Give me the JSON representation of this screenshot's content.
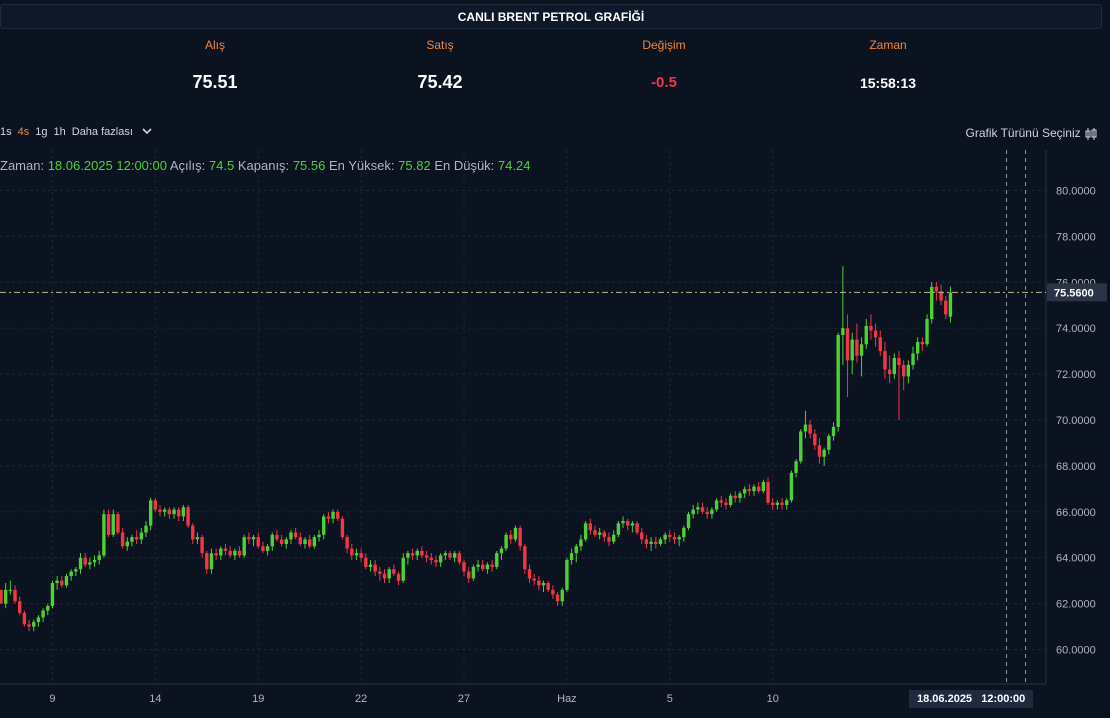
{
  "header": {
    "title": "CANLI BRENT PETROL GRAFİĞİ"
  },
  "stats": [
    {
      "label": "Alış",
      "value": "75.51"
    },
    {
      "label": "Satış",
      "value": "75.42"
    },
    {
      "label": "Değişim",
      "value": "-0.5"
    },
    {
      "label": "Zaman",
      "value": "15:58:13"
    }
  ],
  "toolbar": {
    "intervals": [
      "1s",
      "4s",
      "1g",
      "1h"
    ],
    "active_interval": "4s",
    "more_label": "Daha fazlası",
    "chart_type_label": "Grafik Türünü Seçiniz"
  },
  "ohlc_legend": {
    "time_label": "Zaman:",
    "time_value": "18.06.2025 12:00:00",
    "open_label": "Açılış:",
    "open_value": "74.5",
    "close_label": "Kapanış:",
    "close_value": "75.56",
    "high_label": "En Yüksek:",
    "high_value": "75.82",
    "low_label": "En Düşük:",
    "low_value": "74.24"
  },
  "crosshair_date_label": "18.06.2025   12:00:00",
  "colors": {
    "up": "#4cd137",
    "down": "#f23645",
    "background": "#0b1220",
    "accent": "#f0883e"
  },
  "chart_data": {
    "type": "candlestick",
    "title": "",
    "ylim": [
      58.5,
      81.5
    ],
    "y_ticks": [
      "80.0000",
      "78.0000",
      "76.0000",
      "74.0000",
      "72.0000",
      "70.0000",
      "68.0000",
      "66.0000",
      "64.0000",
      "62.0000",
      "60.0000"
    ],
    "x_ticks": [
      {
        "index": 11,
        "label": "9"
      },
      {
        "index": 33,
        "label": "14"
      },
      {
        "index": 55,
        "label": "19"
      },
      {
        "index": 77,
        "label": "22"
      },
      {
        "index": 99,
        "label": "27"
      },
      {
        "index": 121,
        "label": "Haz"
      },
      {
        "index": 143,
        "label": "5"
      },
      {
        "index": 165,
        "label": "10"
      }
    ],
    "last_price": "75.5600",
    "last_price_value": 75.56,
    "crosshair_index": 215,
    "candles": [
      [
        62.6,
        62.6,
        62.0,
        62.0
      ],
      [
        62.0,
        62.9,
        61.8,
        62.6
      ],
      [
        62.6,
        63.0,
        62.4,
        62.6
      ],
      [
        62.6,
        62.8,
        62.0,
        62.1
      ],
      [
        62.1,
        62.3,
        61.5,
        61.6
      ],
      [
        61.6,
        61.7,
        61.0,
        61.1
      ],
      [
        61.1,
        61.3,
        60.8,
        61.0
      ],
      [
        61.0,
        61.3,
        60.8,
        61.2
      ],
      [
        61.2,
        61.5,
        61.0,
        61.4
      ],
      [
        61.4,
        61.8,
        61.2,
        61.7
      ],
      [
        61.7,
        62.0,
        61.5,
        61.9
      ],
      [
        61.9,
        63.0,
        61.8,
        62.9
      ],
      [
        62.9,
        63.2,
        62.6,
        63.0
      ],
      [
        63.0,
        63.2,
        62.7,
        62.8
      ],
      [
        62.8,
        63.3,
        62.7,
        63.2
      ],
      [
        63.2,
        63.5,
        63.0,
        63.4
      ],
      [
        63.4,
        63.6,
        63.2,
        63.5
      ],
      [
        63.5,
        64.2,
        63.3,
        64.0
      ],
      [
        64.0,
        64.2,
        63.6,
        63.7
      ],
      [
        63.7,
        64.0,
        63.5,
        63.8
      ],
      [
        63.8,
        64.1,
        63.6,
        63.9
      ],
      [
        63.9,
        64.3,
        63.7,
        64.1
      ],
      [
        64.1,
        66.1,
        64.0,
        65.9
      ],
      [
        65.9,
        66.1,
        64.9,
        65.0
      ],
      [
        65.0,
        66.1,
        64.9,
        65.9
      ],
      [
        65.9,
        66.0,
        65.0,
        65.1
      ],
      [
        65.1,
        65.3,
        64.4,
        64.5
      ],
      [
        64.5,
        64.9,
        64.3,
        64.7
      ],
      [
        64.7,
        65.0,
        64.5,
        64.9
      ],
      [
        64.9,
        65.2,
        64.6,
        64.8
      ],
      [
        64.8,
        65.3,
        64.6,
        65.1
      ],
      [
        65.1,
        65.6,
        64.9,
        65.4
      ],
      [
        65.4,
        66.6,
        65.2,
        66.5
      ],
      [
        66.5,
        66.6,
        66.0,
        66.1
      ],
      [
        66.1,
        66.3,
        65.8,
        66.0
      ],
      [
        66.0,
        66.2,
        65.8,
        66.1
      ],
      [
        66.1,
        66.2,
        65.7,
        65.9
      ],
      [
        65.9,
        66.2,
        65.7,
        66.1
      ],
      [
        66.1,
        66.2,
        65.6,
        65.8
      ],
      [
        65.8,
        66.3,
        65.6,
        66.2
      ],
      [
        66.2,
        66.3,
        65.3,
        65.4
      ],
      [
        65.4,
        65.5,
        64.6,
        64.8
      ],
      [
        64.8,
        65.1,
        64.6,
        64.9
      ],
      [
        64.9,
        65.0,
        64.0,
        64.2
      ],
      [
        64.2,
        64.3,
        63.3,
        63.5
      ],
      [
        63.5,
        64.4,
        63.3,
        64.2
      ],
      [
        64.2,
        64.4,
        63.9,
        64.1
      ],
      [
        64.1,
        64.5,
        63.9,
        64.4
      ],
      [
        64.4,
        64.6,
        64.1,
        64.3
      ],
      [
        64.3,
        64.5,
        64.0,
        64.1
      ],
      [
        64.1,
        64.4,
        63.9,
        64.3
      ],
      [
        64.3,
        64.5,
        64.0,
        64.1
      ],
      [
        64.1,
        65.0,
        64.0,
        64.9
      ],
      [
        64.9,
        65.1,
        64.6,
        64.8
      ],
      [
        64.8,
        65.0,
        64.5,
        64.9
      ],
      [
        64.9,
        65.1,
        64.4,
        64.5
      ],
      [
        64.5,
        64.7,
        64.2,
        64.3
      ],
      [
        64.3,
        64.6,
        64.1,
        64.5
      ],
      [
        64.5,
        65.1,
        64.3,
        65.0
      ],
      [
        65.0,
        65.2,
        64.7,
        64.8
      ],
      [
        64.8,
        65.0,
        64.5,
        64.6
      ],
      [
        64.6,
        64.9,
        64.4,
        64.8
      ],
      [
        64.8,
        65.2,
        64.6,
        65.1
      ],
      [
        65.1,
        65.3,
        64.8,
        64.9
      ],
      [
        64.9,
        65.1,
        64.5,
        64.6
      ],
      [
        64.6,
        64.9,
        64.4,
        64.8
      ],
      [
        64.8,
        65.0,
        64.4,
        64.5
      ],
      [
        64.5,
        65.0,
        64.4,
        64.9
      ],
      [
        64.9,
        65.2,
        64.7,
        65.0
      ],
      [
        65.0,
        65.9,
        64.8,
        65.8
      ],
      [
        65.8,
        66.0,
        65.5,
        65.7
      ],
      [
        65.7,
        66.1,
        65.5,
        66.0
      ],
      [
        66.0,
        66.1,
        65.6,
        65.7
      ],
      [
        65.7,
        65.8,
        64.8,
        64.9
      ],
      [
        64.9,
        65.0,
        64.2,
        64.4
      ],
      [
        64.4,
        64.6,
        63.9,
        64.1
      ],
      [
        64.1,
        64.4,
        63.9,
        64.2
      ],
      [
        64.2,
        64.4,
        63.8,
        64.0
      ],
      [
        64.0,
        64.2,
        63.5,
        63.6
      ],
      [
        63.6,
        63.9,
        63.4,
        63.7
      ],
      [
        63.7,
        63.9,
        63.2,
        63.4
      ],
      [
        63.4,
        63.6,
        63.0,
        63.3
      ],
      [
        63.3,
        63.5,
        62.9,
        63.1
      ],
      [
        63.1,
        63.6,
        62.9,
        63.5
      ],
      [
        63.5,
        63.7,
        63.2,
        63.3
      ],
      [
        63.3,
        63.4,
        62.8,
        63.0
      ],
      [
        63.0,
        64.2,
        62.9,
        64.0
      ],
      [
        64.0,
        64.3,
        63.7,
        64.2
      ],
      [
        64.2,
        64.4,
        63.9,
        64.1
      ],
      [
        64.1,
        64.4,
        63.9,
        64.3
      ],
      [
        64.3,
        64.5,
        64.0,
        64.1
      ],
      [
        64.1,
        64.3,
        63.8,
        64.0
      ],
      [
        64.0,
        64.2,
        63.7,
        63.9
      ],
      [
        63.9,
        64.1,
        63.6,
        63.8
      ],
      [
        63.8,
        64.2,
        63.6,
        64.1
      ],
      [
        64.1,
        64.3,
        63.9,
        64.2
      ],
      [
        64.2,
        64.3,
        63.9,
        64.0
      ],
      [
        64.0,
        64.3,
        63.8,
        64.2
      ],
      [
        64.2,
        64.3,
        63.7,
        63.8
      ],
      [
        63.8,
        63.9,
        63.2,
        63.4
      ],
      [
        63.4,
        63.6,
        62.9,
        63.1
      ],
      [
        63.1,
        63.7,
        63.0,
        63.6
      ],
      [
        63.6,
        63.9,
        63.4,
        63.7
      ],
      [
        63.7,
        63.9,
        63.4,
        63.5
      ],
      [
        63.5,
        63.8,
        63.3,
        63.7
      ],
      [
        63.7,
        63.9,
        63.4,
        63.6
      ],
      [
        63.6,
        64.3,
        63.5,
        64.2
      ],
      [
        64.2,
        64.5,
        63.9,
        64.4
      ],
      [
        64.4,
        65.1,
        64.3,
        65.0
      ],
      [
        65.0,
        65.2,
        64.6,
        64.8
      ],
      [
        64.8,
        65.4,
        64.7,
        65.3
      ],
      [
        65.3,
        65.4,
        64.3,
        64.5
      ],
      [
        64.5,
        64.6,
        63.3,
        63.5
      ],
      [
        63.5,
        63.7,
        62.9,
        63.1
      ],
      [
        63.1,
        63.3,
        62.8,
        63.0
      ],
      [
        63.0,
        63.2,
        62.6,
        62.8
      ],
      [
        62.8,
        63.0,
        62.5,
        62.9
      ],
      [
        62.9,
        63.0,
        62.5,
        62.6
      ],
      [
        62.6,
        62.8,
        62.2,
        62.4
      ],
      [
        62.4,
        62.5,
        61.9,
        62.1
      ],
      [
        62.1,
        62.7,
        61.9,
        62.6
      ],
      [
        62.6,
        64.0,
        62.5,
        63.9
      ],
      [
        63.9,
        64.4,
        63.7,
        64.2
      ],
      [
        64.2,
        64.6,
        63.8,
        64.5
      ],
      [
        64.5,
        65.0,
        64.3,
        64.8
      ],
      [
        64.8,
        65.6,
        64.7,
        65.5
      ],
      [
        65.5,
        65.7,
        65.0,
        65.2
      ],
      [
        65.2,
        65.4,
        64.9,
        65.0
      ],
      [
        65.0,
        65.3,
        64.8,
        65.1
      ],
      [
        65.1,
        65.2,
        64.7,
        64.9
      ],
      [
        64.9,
        65.1,
        64.5,
        64.7
      ],
      [
        64.7,
        65.2,
        64.6,
        65.0
      ],
      [
        65.0,
        65.6,
        64.9,
        65.5
      ],
      [
        65.5,
        65.8,
        65.3,
        65.6
      ],
      [
        65.6,
        65.7,
        65.2,
        65.4
      ],
      [
        65.4,
        65.6,
        65.1,
        65.5
      ],
      [
        65.5,
        65.6,
        65.0,
        65.1
      ],
      [
        65.1,
        65.3,
        64.6,
        64.8
      ],
      [
        64.8,
        65.0,
        64.4,
        64.6
      ],
      [
        64.6,
        64.9,
        64.3,
        64.7
      ],
      [
        64.7,
        64.9,
        64.4,
        64.6
      ],
      [
        64.6,
        64.9,
        64.5,
        64.8
      ],
      [
        64.8,
        65.1,
        64.6,
        65.0
      ],
      [
        65.0,
        65.2,
        64.7,
        64.9
      ],
      [
        64.9,
        65.1,
        64.6,
        64.8
      ],
      [
        64.8,
        65.0,
        64.5,
        64.9
      ],
      [
        64.9,
        65.4,
        64.7,
        65.3
      ],
      [
        65.3,
        66.0,
        65.2,
        65.9
      ],
      [
        65.9,
        66.3,
        65.7,
        66.1
      ],
      [
        66.1,
        66.4,
        65.9,
        66.2
      ],
      [
        66.2,
        66.4,
        65.9,
        66.0
      ],
      [
        66.0,
        66.2,
        65.7,
        65.9
      ],
      [
        65.9,
        66.2,
        65.7,
        66.1
      ],
      [
        66.1,
        66.6,
        66.0,
        66.5
      ],
      [
        66.5,
        66.7,
        66.2,
        66.4
      ],
      [
        66.4,
        66.6,
        66.1,
        66.3
      ],
      [
        66.3,
        66.8,
        66.2,
        66.7
      ],
      [
        66.7,
        66.9,
        66.4,
        66.6
      ],
      [
        66.6,
        66.9,
        66.4,
        66.8
      ],
      [
        66.8,
        67.1,
        66.6,
        67.0
      ],
      [
        67.0,
        67.2,
        66.7,
        66.9
      ],
      [
        66.9,
        67.2,
        66.7,
        67.1
      ],
      [
        67.1,
        67.3,
        66.8,
        66.9
      ],
      [
        66.9,
        67.4,
        66.8,
        67.3
      ],
      [
        67.3,
        67.5,
        66.3,
        66.4
      ],
      [
        66.4,
        66.6,
        66.1,
        66.3
      ],
      [
        66.3,
        66.5,
        66.1,
        66.4
      ],
      [
        66.4,
        66.6,
        66.1,
        66.3
      ],
      [
        66.3,
        66.6,
        66.1,
        66.5
      ],
      [
        66.5,
        67.8,
        66.4,
        67.7
      ],
      [
        67.7,
        68.3,
        67.5,
        68.2
      ],
      [
        68.2,
        69.6,
        68.1,
        69.5
      ],
      [
        69.5,
        70.4,
        69.2,
        69.8
      ],
      [
        69.8,
        70.0,
        69.2,
        69.4
      ],
      [
        69.4,
        69.6,
        68.7,
        68.9
      ],
      [
        68.9,
        69.2,
        68.1,
        68.4
      ],
      [
        68.4,
        68.8,
        68.0,
        68.7
      ],
      [
        68.7,
        69.4,
        68.5,
        69.3
      ],
      [
        69.3,
        69.9,
        69.1,
        69.7
      ],
      [
        69.7,
        73.8,
        69.5,
        73.7
      ],
      [
        73.7,
        76.7,
        72.4,
        74.0
      ],
      [
        74.0,
        74.6,
        71.0,
        72.6
      ],
      [
        72.6,
        73.8,
        72.0,
        73.5
      ],
      [
        73.5,
        74.2,
        72.5,
        72.8
      ],
      [
        72.8,
        73.6,
        71.9,
        73.3
      ],
      [
        73.3,
        74.4,
        73.1,
        74.1
      ],
      [
        74.1,
        74.6,
        73.5,
        73.9
      ],
      [
        73.9,
        74.2,
        73.2,
        73.6
      ],
      [
        73.6,
        73.9,
        72.8,
        73.0
      ],
      [
        73.0,
        73.4,
        71.8,
        72.2
      ],
      [
        72.2,
        72.8,
        71.6,
        72.0
      ],
      [
        72.0,
        72.9,
        71.8,
        72.7
      ],
      [
        72.7,
        73.0,
        70.0,
        72.4
      ],
      [
        72.4,
        72.6,
        71.3,
        71.9
      ],
      [
        71.9,
        72.6,
        71.6,
        72.4
      ],
      [
        72.4,
        73.2,
        72.2,
        72.9
      ],
      [
        72.9,
        73.6,
        72.6,
        73.4
      ],
      [
        73.4,
        73.6,
        73.0,
        73.3
      ],
      [
        73.3,
        74.6,
        73.2,
        74.4
      ],
      [
        74.4,
        76.0,
        74.2,
        75.8
      ],
      [
        75.8,
        76.0,
        75.2,
        75.6
      ],
      [
        75.6,
        75.9,
        75.0,
        75.2
      ],
      [
        75.2,
        75.4,
        74.4,
        74.6
      ],
      [
        74.5,
        75.82,
        74.24,
        75.56
      ]
    ]
  }
}
